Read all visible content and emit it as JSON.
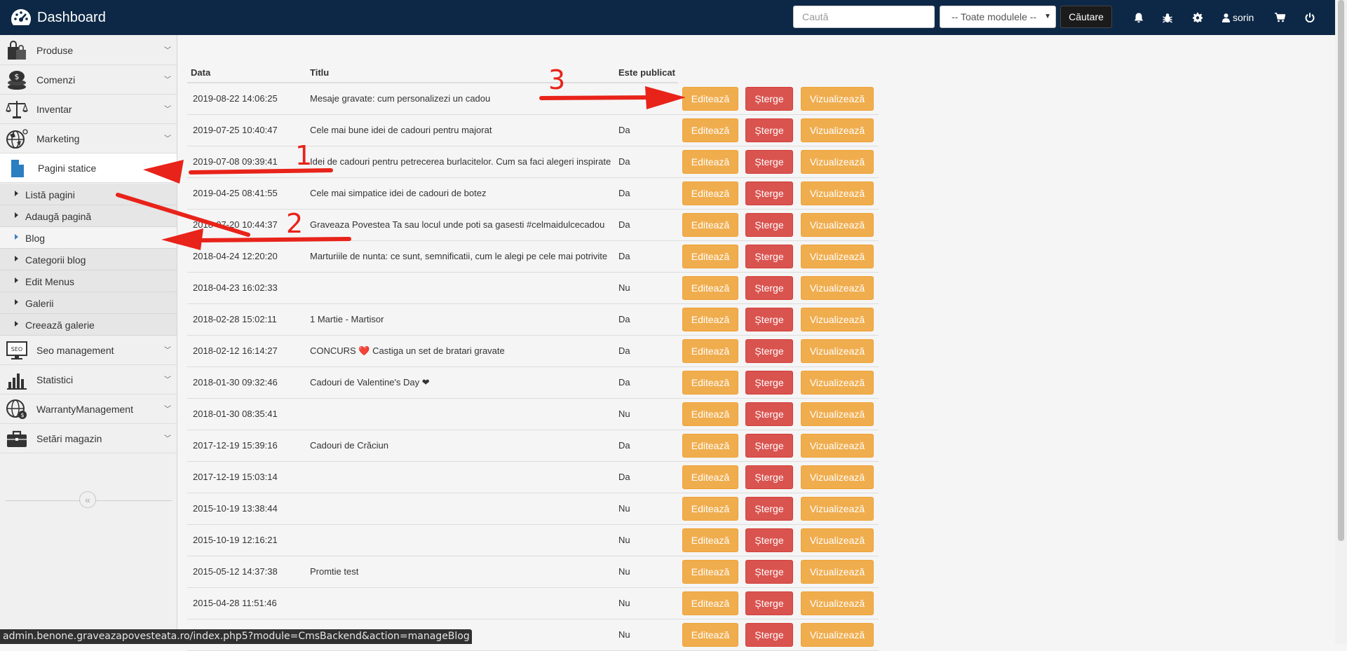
{
  "app": {
    "title": "Dashboard",
    "icon": "dashboard-gauge-icon"
  },
  "header": {
    "search_placeholder": "Caută",
    "module_select": "-- Toate modulele --",
    "search_button": "Căutare",
    "user_name": "sorin",
    "icons": [
      "bell-icon",
      "bug-icon",
      "gear-icon",
      "user-icon",
      "cart-icon",
      "power-icon"
    ]
  },
  "sidebar": {
    "items": [
      {
        "label": "Produse",
        "icon": "shopping-bags-icon"
      },
      {
        "label": "Comenzi",
        "icon": "coins-icon"
      },
      {
        "label": "Inventar",
        "icon": "scales-icon"
      },
      {
        "label": "Marketing",
        "icon": "globe-megaphone-icon"
      },
      {
        "label": "Pagini statice",
        "icon": "document-icon"
      },
      {
        "label": "Seo management",
        "icon": "seo-monitor-icon"
      },
      {
        "label": "Statistici",
        "icon": "bar-chart-icon"
      },
      {
        "label": "WarrantyManagement",
        "icon": "globe-warranty-icon"
      },
      {
        "label": "Setări magazin",
        "icon": "briefcase-icon"
      }
    ],
    "submenu": [
      {
        "label": "Listă pagini"
      },
      {
        "label": "Adaugă pagină"
      },
      {
        "label": "Blog"
      },
      {
        "label": "Categorii blog"
      },
      {
        "label": "Edit Menus"
      },
      {
        "label": "Galerii"
      },
      {
        "label": "Creează galerie"
      }
    ],
    "collapse": "«"
  },
  "table": {
    "headers": {
      "date": "Data",
      "title": "Titlu",
      "published": "Este publicat"
    },
    "buttons": {
      "edit": "Editează",
      "delete": "Șterge",
      "view": "Vizualizează"
    },
    "rows": [
      {
        "date": "2019-08-22 14:06:25",
        "title": "Mesaje gravate: cum personalizezi un cadou",
        "published": ""
      },
      {
        "date": "2019-07-25 10:40:47",
        "title": "Cele mai bune idei de cadouri pentru majorat",
        "published": "Da"
      },
      {
        "date": "2019-07-08 09:39:41",
        "title": "Idei de cadouri pentru petrecerea burlacitelor. Cum sa faci alegeri inspirate",
        "published": "Da"
      },
      {
        "date": "2019-04-25 08:41:55",
        "title": "Cele mai simpatice idei de cadouri de botez",
        "published": "Da"
      },
      {
        "date": "2018-07-20 10:44:37",
        "title": "Graveaza Povestea Ta sau locul unde poti sa gasesti #celmaidulcecadou",
        "published": "Da"
      },
      {
        "date": "2018-04-24 12:20:20",
        "title": "Marturiile de nunta: ce sunt, semnificatii, cum le alegi pe cele mai potrivite",
        "published": "Da"
      },
      {
        "date": "2018-04-23 16:02:33",
        "title": "",
        "published": "Nu"
      },
      {
        "date": "2018-02-28 15:02:11",
        "title": "1 Martie - Martisor",
        "published": "Da"
      },
      {
        "date": "2018-02-12 16:14:27",
        "title": "CONCURS ❤️ Castiga un set de bratari gravate",
        "published": "Da"
      },
      {
        "date": "2018-01-30 09:32:46",
        "title": "Cadouri de Valentine's Day ❤",
        "published": "Da"
      },
      {
        "date": "2018-01-30 08:35:41",
        "title": "",
        "published": "Nu"
      },
      {
        "date": "2017-12-19 15:39:16",
        "title": "Cadouri de Crăciun",
        "published": "Da"
      },
      {
        "date": "2017-12-19 15:03:14",
        "title": "",
        "published": "Da"
      },
      {
        "date": "2015-10-19 13:38:44",
        "title": "",
        "published": "Nu"
      },
      {
        "date": "2015-10-19 12:16:21",
        "title": "",
        "published": "Nu"
      },
      {
        "date": "2015-05-12 14:37:38",
        "title": "Promtie test",
        "published": "Nu"
      },
      {
        "date": "2015-04-28 11:51:46",
        "title": "",
        "published": "Nu"
      },
      {
        "date": "",
        "title": "",
        "published": "Nu"
      }
    ]
  },
  "status_url": "admin.benone.graveazapovesteata.ro/index.php5?module=CmsBackend&action=manageBlog",
  "annotations": {
    "labels": [
      "1",
      "2",
      "3"
    ],
    "color": "#e8231a"
  },
  "colors": {
    "topbar": "#0d2846",
    "edit": "#f0ad4e",
    "delete": "#d9534f",
    "view": "#f0ad4e"
  }
}
